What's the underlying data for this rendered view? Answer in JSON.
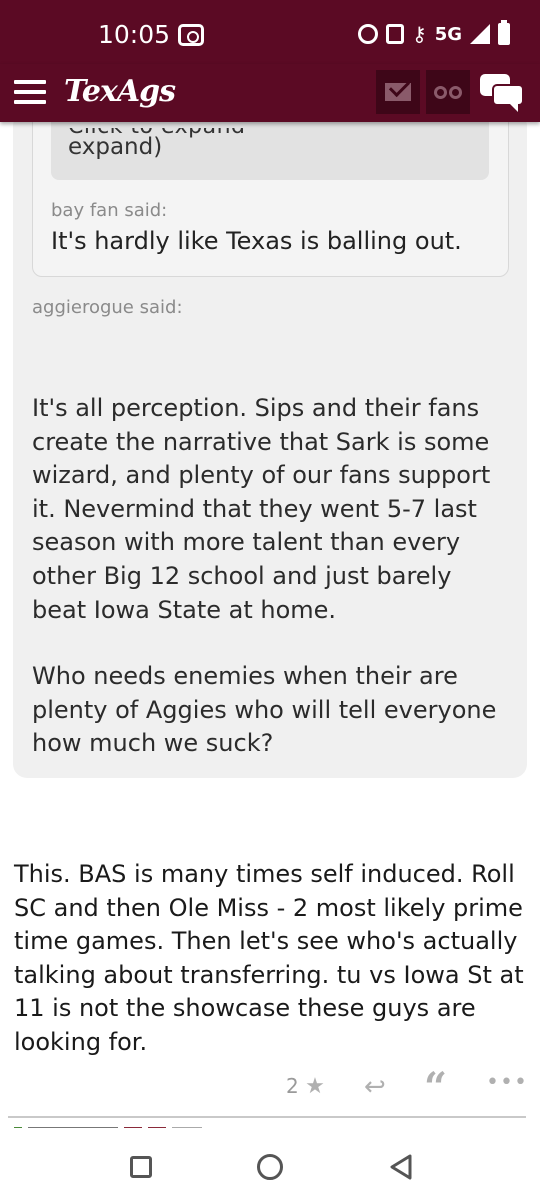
{
  "status_bar": {
    "time": "10:05",
    "network": "5G",
    "icons": [
      "screen-record-icon",
      "alarm-icon",
      "nfc-icon",
      "vpn-key-icon",
      "signal-icon",
      "battery-icon"
    ]
  },
  "header": {
    "logo_text": "TexAgs",
    "icons": [
      "menu-icon",
      "mail-icon",
      "binoculars-icon",
      "chat-icon"
    ],
    "brand_color": "#5b0a24"
  },
  "quotes": {
    "innermost": {
      "cut_text": "Click to expand",
      "expand_text": "expand)"
    },
    "bay_fan": {
      "author_said": "bay fan said:",
      "text": "It's hardly like Texas is balling out."
    },
    "aggierogue": {
      "author_said": "aggierogue said:",
      "paragraph1": "It's all perception. Sips and their fans create the narrative that Sark is some wizard, and plenty of our fans support it. Nevermind that they went 5-7 last season with more talent than every other Big 12 school and just barely beat Iowa State at home.",
      "paragraph2": "Who needs enemies when their are plenty of Aggies who will tell everyone how much we suck?"
    }
  },
  "post": {
    "text": "This. BAS is many times self induced. Roll SC and then Ole Miss - 2 most likely prime time games. Then let's see who's actually talking about transferring. tu vs Iowa St at 11 is not the showcase these guys are looking for.",
    "star_count": "2",
    "star_glyph": "★",
    "reply_glyph": "↩",
    "quote_glyph": "“",
    "more_glyph": "•••"
  },
  "nav_bar": {
    "icons": [
      "recent-apps-icon",
      "home-icon",
      "back-icon"
    ]
  }
}
